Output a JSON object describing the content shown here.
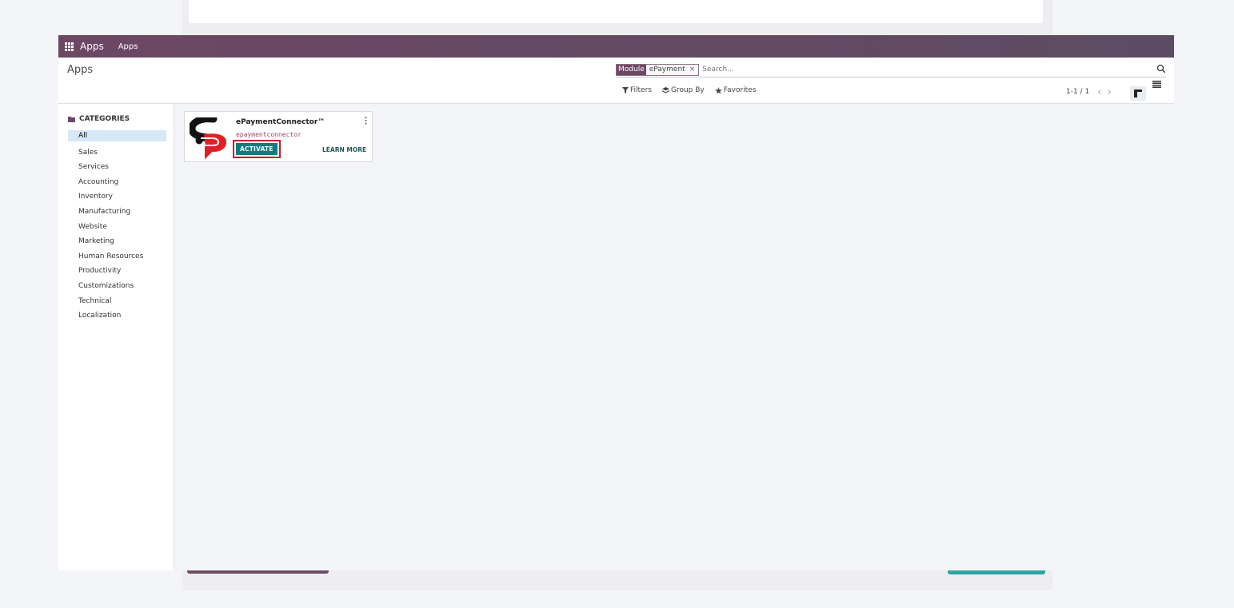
{
  "navbar": {
    "brand": "Apps",
    "menu_item": "Apps"
  },
  "breadcrumb": "Apps",
  "search": {
    "facet_label": "Module",
    "facet_value": "ePayment",
    "facet_remove": "×",
    "placeholder": "Search..."
  },
  "toolbar": {
    "filters": "Filters",
    "group_by": "Group By",
    "favorites": "Favorites"
  },
  "pager": {
    "value": "1-1 / 1",
    "prev": "‹",
    "next": "›"
  },
  "sidebar": {
    "header": "CATEGORIES",
    "items": [
      {
        "label": "All",
        "active": true
      },
      {
        "label": "Sales"
      },
      {
        "label": "Services"
      },
      {
        "label": "Accounting"
      },
      {
        "label": "Inventory"
      },
      {
        "label": "Manufacturing"
      },
      {
        "label": "Website"
      },
      {
        "label": "Marketing"
      },
      {
        "label": "Human Resources"
      },
      {
        "label": "Productivity"
      },
      {
        "label": "Customizations"
      },
      {
        "label": "Technical"
      },
      {
        "label": "Localization"
      }
    ]
  },
  "app_card": {
    "title": "ePaymentConnector™",
    "technical_name": "epaymentconnector",
    "activate_label": "ACTIVATE",
    "learn_more_label": "LEARN MORE"
  },
  "colors": {
    "navbar": "#6d4764",
    "activate_button": "#0f7c7e",
    "highlight_border": "#c4202a",
    "active_category": "#d7e8f7"
  }
}
